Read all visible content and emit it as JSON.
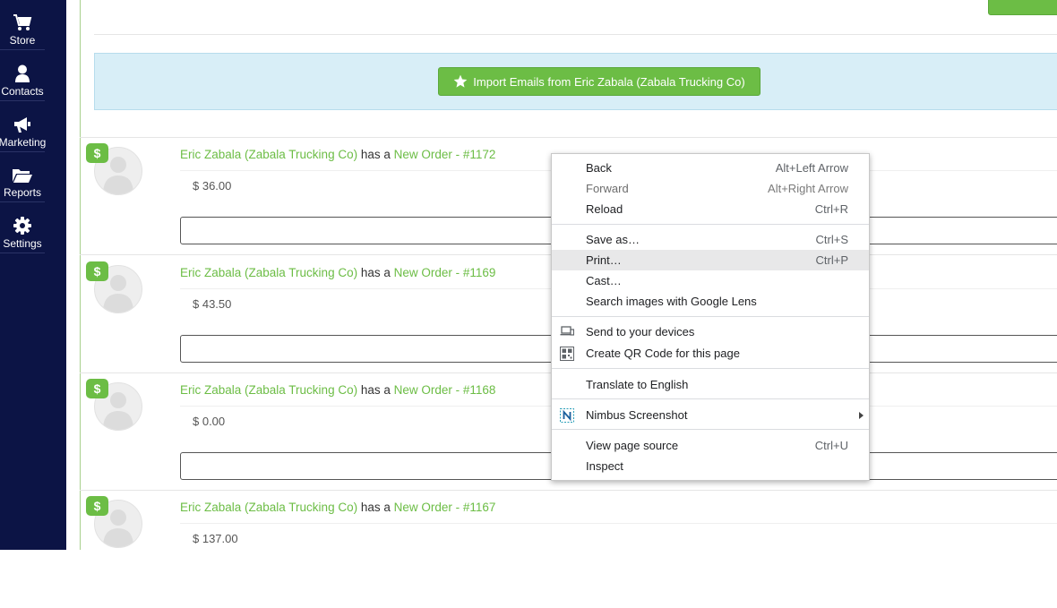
{
  "sidebar": {
    "items": [
      {
        "label": "Store",
        "icon": "cart-icon"
      },
      {
        "label": "Contacts",
        "icon": "person-icon"
      },
      {
        "label": "Marketing",
        "icon": "megaphone-icon"
      },
      {
        "label": "Reports",
        "icon": "folder-icon"
      },
      {
        "label": "Settings",
        "icon": "gear-icon"
      }
    ]
  },
  "import_panel": {
    "button_label": "Import Emails from Eric Zabala (Zabala Trucking Co)",
    "icon": "star-icon"
  },
  "entries": [
    {
      "badge": "$",
      "contact": "Eric Zabala (Zabala Trucking Co)",
      "connector": "has a",
      "order": "New Order - #1172",
      "amount": "$ 36.00"
    },
    {
      "badge": "$",
      "contact": "Eric Zabala (Zabala Trucking Co)",
      "connector": "has a",
      "order": "New Order - #1169",
      "amount": "$ 43.50"
    },
    {
      "badge": "$",
      "contact": "Eric Zabala (Zabala Trucking Co)",
      "connector": "has a",
      "order": "New Order - #1168",
      "amount": "$ 0.00"
    },
    {
      "badge": "$",
      "contact": "Eric Zabala (Zabala Trucking Co)",
      "connector": "has a",
      "order": "New Order - #1167",
      "amount": "$ 137.00"
    }
  ],
  "context_menu": {
    "items": [
      {
        "label": "Back",
        "shortcut": "Alt+Left Arrow"
      },
      {
        "label": "Forward",
        "shortcut": "Alt+Right Arrow",
        "disabled": true
      },
      {
        "label": "Reload",
        "shortcut": "Ctrl+R"
      },
      {
        "label": "Save as…",
        "shortcut": "Ctrl+S"
      },
      {
        "label": "Print…",
        "shortcut": "Ctrl+P",
        "highlighted": true
      },
      {
        "label": "Cast…",
        "shortcut": ""
      },
      {
        "label": "Search images with Google Lens",
        "shortcut": ""
      },
      {
        "label": "Send to your devices",
        "shortcut": "",
        "icon": "devices-icon"
      },
      {
        "label": "Create QR Code for this page",
        "shortcut": "",
        "icon": "qr-code-icon"
      },
      {
        "label": "Translate to English",
        "shortcut": ""
      },
      {
        "label": "Nimbus Screenshot",
        "shortcut": "",
        "icon": "nimbus-icon",
        "submenu": true
      },
      {
        "label": "View page source",
        "shortcut": "Ctrl+U"
      },
      {
        "label": "Inspect",
        "shortcut": ""
      }
    ]
  },
  "colors": {
    "sidebar_bg": "#0c1445",
    "accent_green": "#6cbd45",
    "import_panel_bg": "#d8eef7",
    "menu_highlight": "#e8e8e9"
  }
}
